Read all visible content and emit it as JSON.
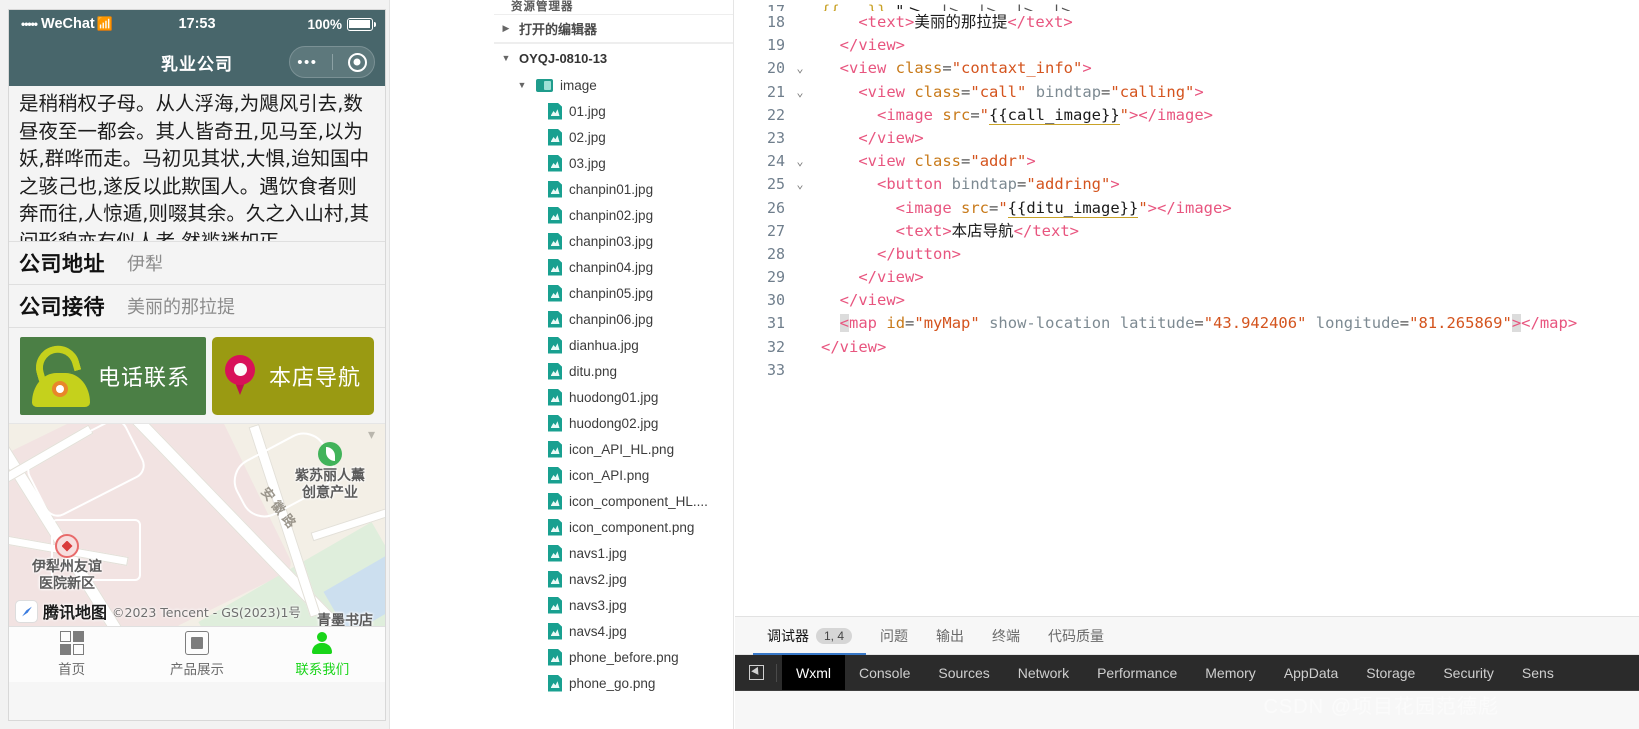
{
  "simulator": {
    "status_bar": {
      "signal_dots": "•••••",
      "carrier": "WeChat",
      "wifi_icon": "wifi-icon",
      "time": "17:53",
      "battery_pct": "100%"
    },
    "nav": {
      "title": "乳业公司",
      "capsule_dots": "•••",
      "capsule_circle_icon": "target-circle-icon"
    },
    "article": "是稍稍权子母。从人浮海,为飓风引去,数昼夜至一都会。其人皆奇丑,见马至,以为妖,群哗而走。马初见其状,大惧,迨知国中之骇己也,遂反以此欺国人。遇饮食者则奔而往,人惊遁,则啜其余。久之入山村,其间形貌亦有似人者,然褴褛如丐。",
    "info_rows": [
      {
        "label": "公司地址",
        "value": "伊犁"
      },
      {
        "label": "公司接待",
        "value": "美丽的那拉提"
      }
    ],
    "buttons": {
      "call": {
        "label": "电话联系",
        "icon": "telephone-icon",
        "color": "#4b7f45"
      },
      "nav": {
        "label": "本店导航",
        "icon": "map-pin-icon",
        "color": "#9a9a12"
      }
    },
    "map": {
      "street_label": "安徽路",
      "pois": [
        {
          "name": "伊犁州友谊\n医院新区",
          "line1": "伊犁州友谊",
          "line2": "医院新区",
          "icon": "hospital-marker-icon"
        },
        {
          "name": "紫苏丽人薰",
          "line1": "紫苏丽人薰",
          "line2": "创意产业",
          "icon": "green-leaf-marker-icon"
        },
        {
          "name": "青墨书店",
          "line1": "青墨书店",
          "line2": "",
          "icon": ""
        }
      ],
      "provider": "腾讯地图",
      "copyright": "©2023 Tencent - GS(2023)1号",
      "collapse_icon": "chevron-down-icon"
    },
    "tabbar": [
      {
        "label": "首页",
        "icon": "grid-icon",
        "active": false
      },
      {
        "label": "产品展示",
        "icon": "chip-icon",
        "active": false
      },
      {
        "label": "联系我们",
        "icon": "user-icon",
        "active": true
      }
    ]
  },
  "explorer": {
    "panel_title": "资源管理器",
    "sections": [
      {
        "label": "打开的编辑器",
        "expanded": false,
        "twisty": "▶"
      },
      {
        "label": "OYQJ-0810-13",
        "expanded": true,
        "twisty": "▼"
      }
    ],
    "folder": {
      "label": "image",
      "twisty": "▼",
      "icon": "folder-image-icon"
    },
    "files": [
      "01.jpg",
      "02.jpg",
      "03.jpg",
      "chanpin01.jpg",
      "chanpin02.jpg",
      "chanpin03.jpg",
      "chanpin04.jpg",
      "chanpin05.jpg",
      "chanpin06.jpg",
      "dianhua.jpg",
      "ditu.png",
      "huodong01.jpg",
      "huodong02.jpg",
      "icon_API_HL.png",
      "icon_API.png",
      "icon_component_HL....",
      "icon_component.png",
      "navs1.jpg",
      "navs2.jpg",
      "navs3.jpg",
      "navs4.jpg",
      "phone_before.png",
      "phone_go.png"
    ]
  },
  "editor": {
    "lines": [
      {
        "no": "18",
        "fold": "",
        "indent": 2
      },
      {
        "no": "19",
        "fold": "",
        "indent": 1
      },
      {
        "no": "20",
        "fold": "⌄",
        "indent": 1
      },
      {
        "no": "21",
        "fold": "⌄",
        "indent": 2
      },
      {
        "no": "22",
        "fold": "",
        "indent": 3
      },
      {
        "no": "23",
        "fold": "",
        "indent": 2
      },
      {
        "no": "24",
        "fold": "⌄",
        "indent": 2
      },
      {
        "no": "25",
        "fold": "⌄",
        "indent": 3
      },
      {
        "no": "26",
        "fold": "",
        "indent": 4
      },
      {
        "no": "27",
        "fold": "",
        "indent": 4
      },
      {
        "no": "28",
        "fold": "",
        "indent": 3
      },
      {
        "no": "29",
        "fold": "",
        "indent": 2
      },
      {
        "no": "30",
        "fold": "",
        "indent": 1
      },
      {
        "no": "31",
        "fold": "",
        "indent": 1
      },
      {
        "no": "32",
        "fold": "",
        "indent": 0
      },
      {
        "no": "33",
        "fold": "",
        "indent": 0
      }
    ],
    "code": {
      "l18_text": "美丽的那拉提",
      "l20_class": "contaxt_info",
      "l21_class": "call",
      "l21_bindtap": "calling",
      "l22_src": "{{call_image}}",
      "l24_class": "addr",
      "l25_bindtap": "addring",
      "l26_src": "{{ditu_image}}",
      "l27_text": "本店导航",
      "l31_id": "myMap",
      "l31_attr": "show-location",
      "l31_latitude": "43.942406",
      "l31_longitude": "81.265869"
    }
  },
  "bottom_panel": {
    "debug_tabs": [
      {
        "label": "调试器",
        "badge": "1, 4",
        "active": true
      },
      {
        "label": "问题",
        "badge": "",
        "active": false
      },
      {
        "label": "输出",
        "badge": "",
        "active": false
      },
      {
        "label": "终端",
        "badge": "",
        "active": false
      },
      {
        "label": "代码质量",
        "badge": "",
        "active": false
      }
    ],
    "devtools_tabs": [
      {
        "label": "Wxml",
        "active": true
      },
      {
        "label": "Console",
        "active": false
      },
      {
        "label": "Sources",
        "active": false
      },
      {
        "label": "Network",
        "active": false
      },
      {
        "label": "Performance",
        "active": false
      },
      {
        "label": "Memory",
        "active": false
      },
      {
        "label": "AppData",
        "active": false
      },
      {
        "label": "Storage",
        "active": false
      },
      {
        "label": "Security",
        "active": false
      },
      {
        "label": "Sens",
        "active": false
      }
    ],
    "inspect_icon": "inspect-cursor-icon",
    "watermark": "CSDN @项目花园范德彪"
  }
}
